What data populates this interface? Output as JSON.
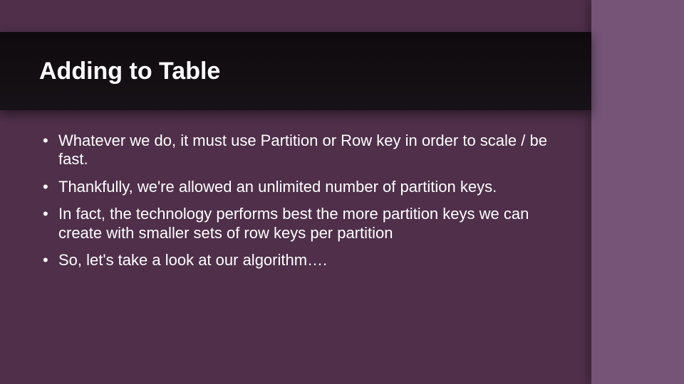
{
  "slide": {
    "title": "Adding to Table",
    "bullets": [
      "Whatever we do, it must use Partition or Row key in order to scale / be fast.",
      "Thankfully, we're allowed an unlimited number of partition keys.",
      "In fact, the technology performs best the more partition keys we can create with smaller sets of row keys per partition",
      "So, let's take a look at our algorithm…."
    ]
  },
  "colors": {
    "background": "#4f2f4a",
    "stripe": "#755477",
    "header": "#0e0a0d",
    "text": "#ffffff"
  }
}
